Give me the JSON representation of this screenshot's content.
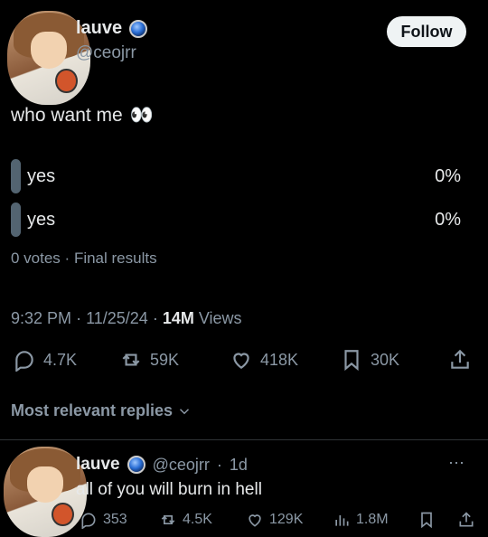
{
  "post": {
    "author_name": "lauve",
    "author_handle": "@ceojrr",
    "follow_label": "Follow",
    "text": "who want me",
    "emoji": "👀",
    "poll": {
      "options": [
        {
          "label": "yes",
          "percent": "0%"
        },
        {
          "label": "yes",
          "percent": "0%"
        }
      ],
      "votes": "0 votes",
      "status": "Final results"
    },
    "time": "9:32 PM",
    "date": "11/25/24",
    "views_count": "14M",
    "views_label": "Views",
    "stats": {
      "replies": "4.7K",
      "reposts": "59K",
      "likes": "418K",
      "bookmarks": "30K"
    }
  },
  "replies_filter": "Most relevant replies",
  "reply": {
    "author_name": "lauve",
    "author_handle": "@ceojrr",
    "age": "1d",
    "text": "all of you will burn in hell",
    "stats": {
      "replies": "353",
      "reposts": "4.5K",
      "likes": "129K",
      "views": "1.8M"
    }
  },
  "colors": {
    "background": "#000000",
    "text": "#e7e9ea",
    "muted": "#8b98a5",
    "poll_bar": "#536471"
  }
}
